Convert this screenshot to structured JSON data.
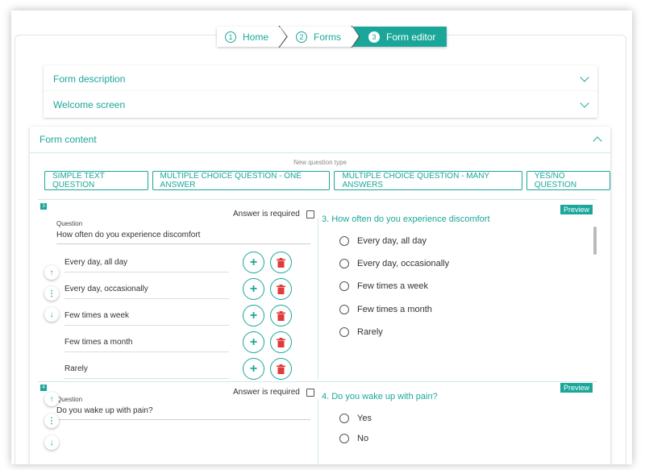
{
  "breadcrumb": [
    {
      "num": "1",
      "label": "Home"
    },
    {
      "num": "2",
      "label": "Forms"
    },
    {
      "num": "3",
      "label": "Form editor"
    }
  ],
  "sections": {
    "form_description": "Form description",
    "welcome_screen": "Welcome screen",
    "form_content": "Form content"
  },
  "new_question_type_label": "New question type",
  "question_types": [
    "SIMPLE TEXT QUESTION",
    "MULTIPLE CHOICE QUESTION - ONE ANSWER",
    "MULTIPLE CHOICE QUESTION - MANY ANSWERS",
    "YES/NO QUESTION"
  ],
  "questions": [
    {
      "num": "3",
      "question_label": "Question",
      "text": "How often do you experience discomfort",
      "required_label": "Answer is required",
      "answers": [
        "Every day, all day",
        "Every day, occasionally",
        "Few times a week",
        "Few times a month",
        "Rarely"
      ],
      "preview_label": "Preview",
      "preview_title": "3. How often do you experience discomfort"
    },
    {
      "num": "4",
      "question_label": "Question",
      "text": "Do you wake up with pain?",
      "required_label": "Answer is required",
      "answers": [
        "Yes",
        "No"
      ],
      "preview_label": "Preview",
      "preview_title": "4. Do you wake up with pain?"
    }
  ],
  "colors": {
    "accent": "#1aa79a",
    "danger": "#e03a3a"
  },
  "icons": {
    "up": "arrow-up-icon",
    "down": "arrow-down-icon",
    "drag": "drag-handle-icon",
    "add": "plus-icon",
    "delete": "trash-icon"
  }
}
